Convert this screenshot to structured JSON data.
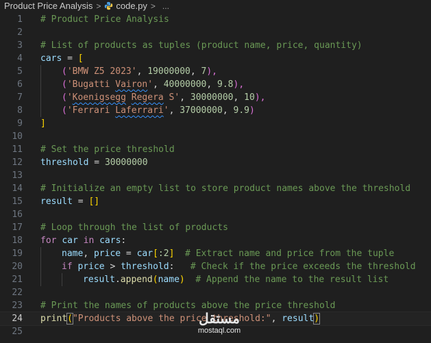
{
  "breadcrumb": {
    "folder": "Product Price Analysis",
    "file": "code.py",
    "separator": ">"
  },
  "editor": {
    "current_line": 24,
    "line_numbers": [
      "1",
      "2",
      "3",
      "4",
      "5",
      "6",
      "7",
      "8",
      "9",
      "10",
      "11",
      "12",
      "13",
      "14",
      "15",
      "16",
      "17",
      "18",
      "19",
      "20",
      "21",
      "22",
      "23",
      "24",
      "25"
    ],
    "code": {
      "l1": "# Product Price Analysis",
      "l3": "# List of products as tuples (product name, price, quantity)",
      "l4_var": "cars",
      "l4_eq": " = ",
      "l4_br": "[",
      "l5_open": "(",
      "l5_str": "'BMW Z5 2023'",
      "l5_c1": ", ",
      "l5_n1": "19000000",
      "l5_c2": ", ",
      "l5_n2": "7",
      "l5_close": "),",
      "l6_open": "(",
      "l6_s1": "'Bugatti ",
      "l6_sq": "Vairon",
      "l6_s2": "'",
      "l6_c1": ", ",
      "l6_n1": "40000000",
      "l6_c2": ", ",
      "l6_n2": "9.8",
      "l6_close": "),",
      "l7_open": "(",
      "l7_s1": "'",
      "l7_sq1": "Koenigsegg",
      "l7_sp": " ",
      "l7_sq2": "Regera",
      "l7_s2": " S'",
      "l7_c1": ", ",
      "l7_n1": "30000000",
      "l7_c2": ", ",
      "l7_n2": "10",
      "l7_close": "),",
      "l8_open": "(",
      "l8_s1": "'Ferrari ",
      "l8_sq": "Laferrari",
      "l8_s2": "'",
      "l8_c1": ", ",
      "l8_n1": "37000000",
      "l8_c2": ", ",
      "l8_n2": "9.9",
      "l8_close": ")",
      "l9": "]",
      "l11": "# Set the price threshold",
      "l12_var": "threshold",
      "l12_eq": " = ",
      "l12_num": "30000000",
      "l14": "# Initialize an empty list to store product names above the threshold",
      "l15_var": "result",
      "l15_eq": " = ",
      "l15_br": "[]",
      "l17": "# Loop through the list of products",
      "l18_for": "for",
      "l18_sp1": " ",
      "l18_var": "car",
      "l18_sp2": " ",
      "l18_in": "in",
      "l18_sp3": " ",
      "l18_iter": "cars",
      "l18_colon": ":",
      "l19_name": "name",
      "l19_comma": ", ",
      "l19_price": "price",
      "l19_eq": " = ",
      "l19_car": "car",
      "l19_slice_open": "[",
      "l19_slice": ":2",
      "l19_slice_close": "]",
      "l19_comment": "  # Extract name and price from the tuple",
      "l20_if": "if",
      "l20_sp": " ",
      "l20_price": "price",
      "l20_gt": " > ",
      "l20_thr": "threshold",
      "l20_colon": ":",
      "l20_comment": "   # Check if the price exceeds the threshold",
      "l21_res": "result",
      "l21_dot": ".",
      "l21_fn": "append",
      "l21_open": "(",
      "l21_arg": "name",
      "l21_close": ")",
      "l21_comment": "  # Append the name to the result list",
      "l23": "# Print the names of products above the price threshold",
      "l24_fn": "print",
      "l24_open": "(",
      "l24_str": "\"Products above the price threshold:\"",
      "l24_comma": ", ",
      "l24_arg": "result",
      "l24_close": ")"
    }
  },
  "watermark": {
    "mark": "مستقل",
    "text": "mostaql.com"
  },
  "colors": {
    "background": "#1f1f1f",
    "comment": "#6a9955",
    "keyword": "#c586c0",
    "variable": "#9cdcfe",
    "function": "#dcdcaa",
    "string": "#ce9178",
    "number": "#b5cea8"
  }
}
